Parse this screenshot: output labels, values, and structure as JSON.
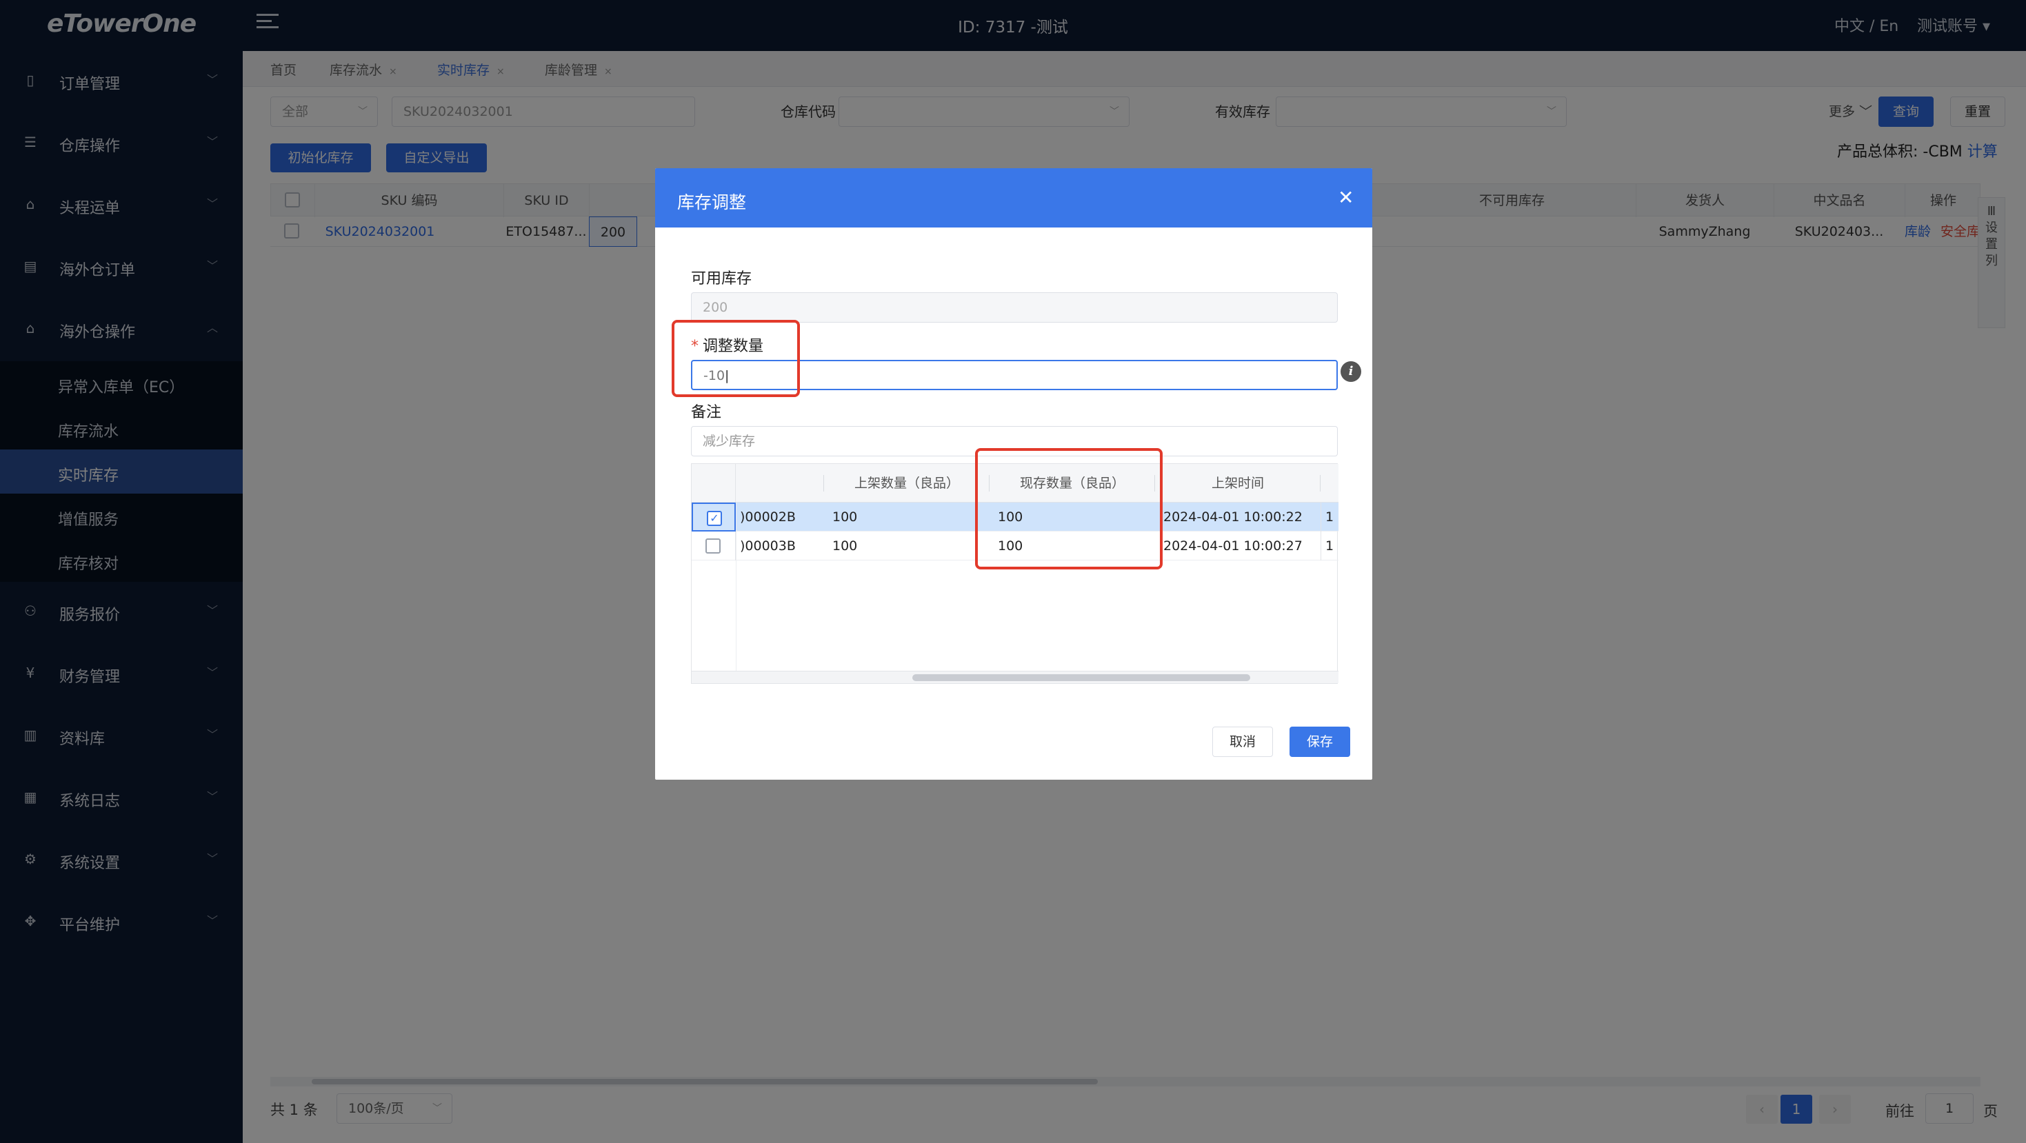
{
  "app": {
    "logo": "eTowerOne",
    "title": "ID: 7317 -测试",
    "lang": "中文 / En",
    "account": "测试账号 ▾"
  },
  "sidebar": {
    "items": [
      {
        "label": "订单管理",
        "icon": "order-icon"
      },
      {
        "label": "仓库操作",
        "icon": "warehouse-icon"
      },
      {
        "label": "头程运单",
        "icon": "shipping-icon"
      },
      {
        "label": "海外仓订单",
        "icon": "overseas-order-icon"
      },
      {
        "label": "海外仓操作",
        "icon": "overseas-ops-icon"
      },
      {
        "label": "服务报价",
        "icon": "quote-icon"
      },
      {
        "label": "财务管理",
        "icon": "finance-icon"
      },
      {
        "label": "资料库",
        "icon": "library-icon"
      },
      {
        "label": "系统日志",
        "icon": "log-icon"
      },
      {
        "label": "系统设置",
        "icon": "settings-icon"
      },
      {
        "label": "平台维护",
        "icon": "platform-icon"
      }
    ],
    "sub_items": [
      "异常入库单（EC）",
      "库存流水",
      "实时库存",
      "增值服务",
      "库存核对"
    ],
    "active_sub": "实时库存"
  },
  "tabs": [
    {
      "label": "首页",
      "closable": false
    },
    {
      "label": "库存流水",
      "closable": true
    },
    {
      "label": "实时库存",
      "closable": true,
      "active": true
    },
    {
      "label": "库龄管理",
      "closable": true
    }
  ],
  "filters": {
    "scope_select": "全部",
    "sku_input": "SKU2024032001",
    "warehouse_code_label": "仓库代码",
    "valid_stock_label": "有效库存",
    "more_label": "更多",
    "query_button": "查询",
    "reset_button": "重置"
  },
  "toolbar": {
    "init_button": "初始化库存",
    "export_button": "自定义导出",
    "total_text": "产品总体积: -CBM",
    "calc_link": "计算"
  },
  "grid": {
    "columns": [
      "SKU 编码",
      "SKU ID",
      "不可用库存",
      "发货人",
      "中文品名",
      "操作"
    ],
    "row": {
      "sku_code": "SKU2024032001",
      "sku_id": "ETO15487...",
      "stock": "200",
      "shipper": "SammyZhang",
      "cn_name": "SKU202403...",
      "action_age": "库龄",
      "action_safety": "安全库存"
    },
    "side_tool": "设置列"
  },
  "pager": {
    "total": "共 1 条",
    "page_size": "100条/页",
    "current_page": "1",
    "goto_label": "前往",
    "goto_value": "1",
    "page_unit": "页"
  },
  "dialog": {
    "title": "库存调整",
    "available_label": "可用库存",
    "available_value": "200",
    "adjust_label": "调整数量",
    "adjust_value": "-10",
    "remark_label": "备注",
    "remark_placeholder": "减少库存",
    "table": {
      "columns": [
        "上架数量（良品）",
        "现存数量（良品）",
        "上架时间"
      ],
      "rows": [
        {
          "batch": ")00002B",
          "shelved": "100",
          "current": "100",
          "time": "2024-04-01 10:00:22",
          "extra": "1",
          "checked": true
        },
        {
          "batch": ")00003B",
          "shelved": "100",
          "current": "100",
          "time": "2024-04-01 10:00:27",
          "extra": "1",
          "checked": false
        }
      ]
    },
    "cancel_button": "取消",
    "save_button": "保存"
  },
  "colors": {
    "sidebar_bg": "#0d1b33",
    "primary": "#2f6be3",
    "dialog_header": "#3a77e8",
    "highlight_box": "#e23a2b"
  }
}
